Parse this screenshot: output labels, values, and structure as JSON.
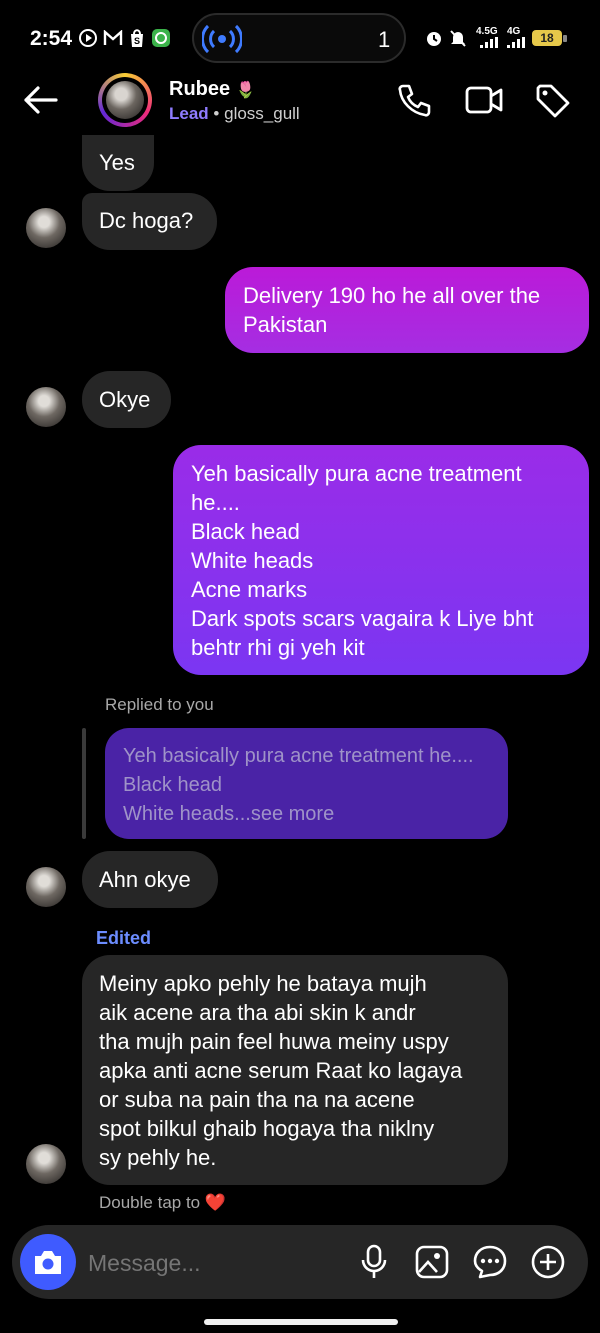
{
  "status_bar": {
    "time": "2:54",
    "island_count": "1",
    "net1": "4.5G",
    "net2": "4G",
    "battery": "18"
  },
  "header": {
    "name": "Rubee",
    "name_emoji": "🌷",
    "lead_label": "Lead",
    "separator": "•",
    "username": "gloss_gull"
  },
  "messages": [
    {
      "side": "in",
      "text": "Yes"
    },
    {
      "side": "in",
      "text": "Dc hoga?"
    },
    {
      "side": "out",
      "lines": [
        "Delivery 190 ho he all over the",
        "Pakistan"
      ]
    },
    {
      "side": "in",
      "text": "Okye"
    },
    {
      "side": "out",
      "lines": [
        "Yeh basically pura acne treatment",
        "he....",
        "Black head",
        "White heads",
        "Acne marks",
        "Dark spots scars vagaira k Liye bht",
        "behtr rhi gi yeh kit"
      ]
    },
    {
      "side": "in",
      "text": "Ahn okye"
    },
    {
      "side": "in",
      "lines": [
        "Meiny apko pehly he bataya mujh",
        "aik acene ara tha abi skin k andr",
        "tha mujh pain feel huwa meiny uspy",
        "apka anti acne serum Raat ko lagaya",
        "or suba na pain tha na na acene",
        "spot bilkul ghaib hogaya tha niklny",
        "sy pehly he."
      ]
    }
  ],
  "reply": {
    "label": "Replied to you",
    "quote_lines": [
      "Yeh basically pura acne treatment he....",
      "Black head",
      "White heads...see more"
    ]
  },
  "edited_label": "Edited",
  "double_tap": {
    "text": "Double tap to",
    "emoji": "❤️"
  },
  "composer": {
    "placeholder": "Message..."
  },
  "colors": {
    "out_bubble_top": "#b21fe0",
    "out_bubble_bottom": "#7c35f0",
    "in_bubble": "#262626",
    "accent_blue": "#3f5bff",
    "lead_purple": "#8f7cff"
  }
}
